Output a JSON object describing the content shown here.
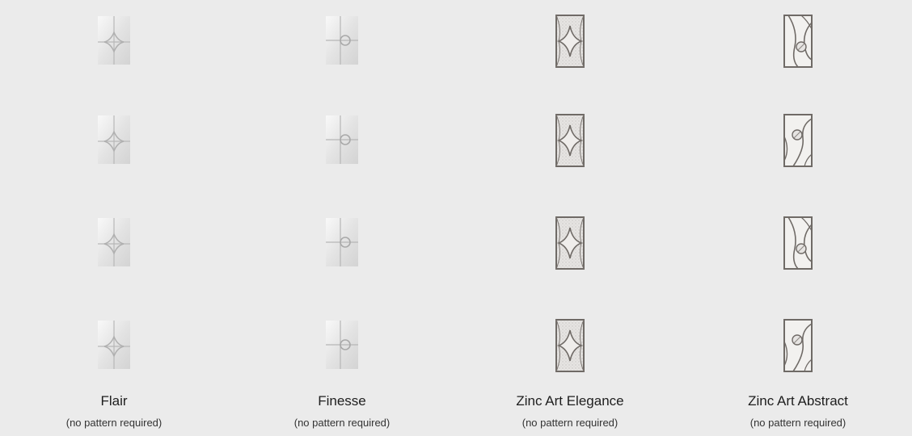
{
  "options": [
    {
      "name": "Flair",
      "note": "(no pattern required)",
      "icon": "flair-glass-icon"
    },
    {
      "name": "Finesse",
      "note": "(no pattern required)",
      "icon": "finesse-glass-icon"
    },
    {
      "name": "Zinc Art Elegance",
      "note": "(no pattern required)",
      "icon": "zinc-art-elegance-glass-icon"
    },
    {
      "name": "Zinc Art Abstract",
      "note": "(no pattern required)",
      "icon": "zinc-art-abstract-glass-icon"
    }
  ],
  "colors": {
    "background": "#ebebeb",
    "frame": "#6f6a66",
    "glass_light": "#f4f4f4",
    "glass_shade": "#c9c9c9"
  }
}
